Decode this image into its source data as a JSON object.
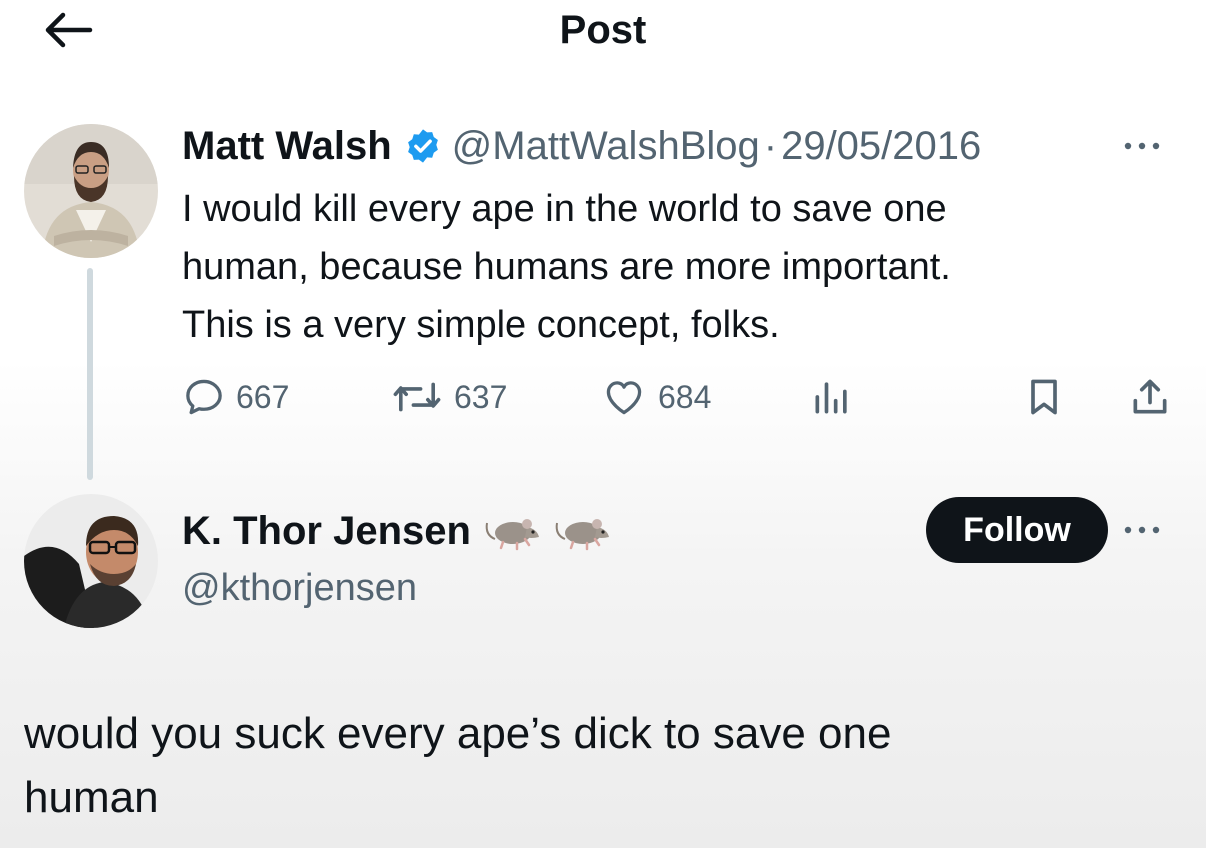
{
  "header": {
    "title": "Post",
    "back_icon": "arrow-left-icon"
  },
  "tweet": {
    "author_name": "Matt Walsh",
    "verified": true,
    "verified_color": "#1d9bf0",
    "handle": "@MattWalshBlog",
    "separator": "·",
    "date": "29/05/2016",
    "lines": [
      "I would kill every ape in the world to save one",
      "human, because humans are more important.",
      "This is a very simple concept, folks."
    ],
    "replies": "667",
    "reposts": "637",
    "likes": "684"
  },
  "reply": {
    "author_name": "K. Thor Jensen",
    "name_emoji": [
      "rat-emoji",
      "rat-emoji"
    ],
    "handle": "@kthorjensen",
    "follow_label": "Follow",
    "lines": [
      "would you suck every ape’s dick to save one",
      "human"
    ]
  },
  "colors": {
    "text": "#0f1419",
    "secondary": "#536471",
    "follow_bg": "#0f1419"
  }
}
